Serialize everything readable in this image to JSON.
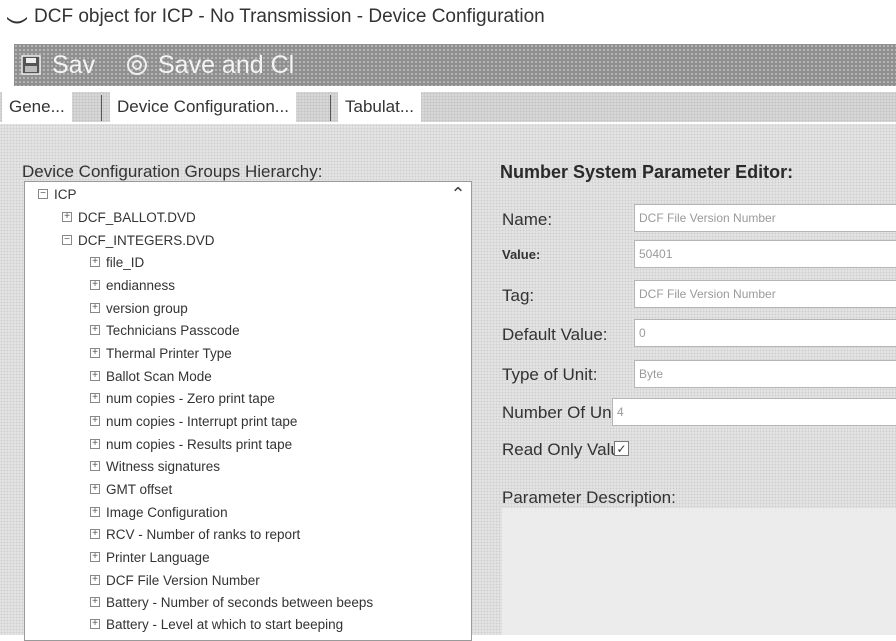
{
  "window": {
    "title": "DCF object for ICP - No Transmission - Device Configuration",
    "icon": "app-tray-icon"
  },
  "toolbar": {
    "save_label": "Sav",
    "save_icon": "floppy-disk-icon",
    "save_close_label": "Save and Cl",
    "save_close_icon": "gear-circle-icon"
  },
  "tabs": [
    {
      "label": "Gene..."
    },
    {
      "label": "Device Configuration..."
    },
    {
      "label": "Tabulat..."
    }
  ],
  "hierarchy": {
    "label": "Device Configuration Groups Hierarchy:",
    "root": "ICP",
    "groups": [
      "DCF_BALLOT.DVD",
      "DCF_INTEGERS.DVD"
    ],
    "items": [
      "file_ID",
      "endianness",
      "version group",
      "Technicians Passcode",
      "Thermal Printer Type",
      "Ballot Scan Mode",
      "num copies - Zero print tape",
      "num copies - Interrupt print tape",
      "num copies - Results print tape",
      "Witness signatures",
      "GMT offset",
      "Image Configuration",
      "RCV - Number of ranks to report",
      "Printer Language",
      "DCF File Version Number",
      "Battery - Number of seconds between beeps",
      "Battery - Level at which to start beeping"
    ]
  },
  "editor": {
    "title": "Number System Parameter Editor:",
    "name_label": "Name:",
    "name_value": "DCF File Version Number",
    "value_label": "Value:",
    "value_value": "50401",
    "tag_label": "Tag:",
    "tag_value": "DCF File Version Number",
    "default_label": "Default Value:",
    "default_value": "0",
    "unit_type_label": "Type of Unit:",
    "unit_type_value": "Byte",
    "unit_count_label": "Number Of Unit",
    "unit_count_value": "4",
    "readonly_label": "Read Only Value",
    "readonly_checked": true,
    "description_label": "Parameter Description:"
  }
}
